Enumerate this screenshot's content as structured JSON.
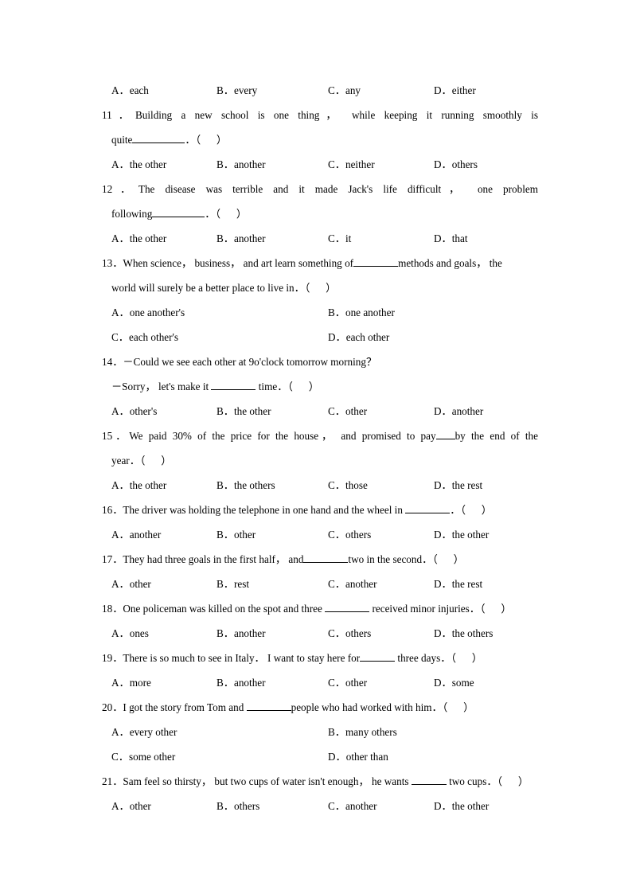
{
  "document": {
    "type": "english-grammar-worksheet",
    "page_background": "#ffffff",
    "text_color": "#000000"
  },
  "questions": [
    {
      "id": "q10-options",
      "number": "",
      "stem_lines": [],
      "option_layout": "cols4",
      "options": [
        {
          "label": "A．",
          "text": "each"
        },
        {
          "label": "B．",
          "text": "every"
        },
        {
          "label": "C．",
          "text": "any"
        },
        {
          "label": "D．",
          "text": "either"
        }
      ]
    },
    {
      "id": "q11",
      "number": "11．",
      "justified": true,
      "stem_line1": "Building a new school is one thing， while keeping it running smoothly is",
      "stem_line2_prefix": "quite",
      "stem_line2_suffix": "．（      ）",
      "blank_size": "w-l",
      "option_layout": "cols4",
      "options": [
        {
          "label": "A．",
          "text": "the other"
        },
        {
          "label": "B．",
          "text": "another"
        },
        {
          "label": "C．",
          "text": "neither"
        },
        {
          "label": "D．",
          "text": "others"
        }
      ]
    },
    {
      "id": "q12",
      "number": "12．",
      "justified": true,
      "stem_line1": "The disease was terrible and it made Jack's life difficult， one problem",
      "stem_line2_prefix": "following",
      "stem_line2_suffix": "．（      ）",
      "blank_size": "w-l",
      "option_layout": "cols4",
      "options": [
        {
          "label": "A．",
          "text": "the other"
        },
        {
          "label": "B．",
          "text": "another"
        },
        {
          "label": "C．",
          "text": "it"
        },
        {
          "label": "D．",
          "text": "that"
        }
      ]
    },
    {
      "id": "q13",
      "number": "13．",
      "justified": false,
      "stem_line1_pre": "When science， business， and art learn something of",
      "stem_line1_post": "methods and goals， the",
      "stem_line2": "world will surely be a better place to live in．（      ）",
      "blank_size": "w-m",
      "option_layout": "cols2",
      "options": [
        {
          "label": "A．",
          "text": "one another's"
        },
        {
          "label": "B．",
          "text": "one another"
        },
        {
          "label": "C．",
          "text": "each other's"
        },
        {
          "label": "D．",
          "text": "each other"
        }
      ]
    },
    {
      "id": "q14",
      "number": "14．",
      "stem_line1": "－Could we see each other at 9o'clock tomorrow morning？",
      "stem_line2_pre": "－Sorry， let's make it ",
      "stem_line2_post": " time．（      ）",
      "blank_size": "w-m",
      "option_layout": "cols4",
      "options": [
        {
          "label": "A．",
          "text": "other's"
        },
        {
          "label": "B．",
          "text": "the other"
        },
        {
          "label": "C．",
          "text": "other"
        },
        {
          "label": "D．",
          "text": "another"
        }
      ]
    },
    {
      "id": "q15",
      "number": "15．",
      "justified": true,
      "stem_line1_pre": "We paid 30% of the price for the house， and promised to pay",
      "stem_line1_post": "by the end of the",
      "stem_line2": "year．（      ）",
      "blank_size": "w-xs",
      "option_layout": "cols4",
      "options": [
        {
          "label": "A．",
          "text": "the other"
        },
        {
          "label": "B．",
          "text": "the others"
        },
        {
          "label": "C．",
          "text": "those"
        },
        {
          "label": "D．",
          "text": "the rest"
        }
      ]
    },
    {
      "id": "q16",
      "number": "16．",
      "stem_pre": "The driver was holding the telephone in one hand and the wheel in ",
      "stem_post": "．（      ）",
      "blank_size": "w-m",
      "option_layout": "cols4",
      "options": [
        {
          "label": "A．",
          "text": "another"
        },
        {
          "label": "B．",
          "text": "other"
        },
        {
          "label": "C．",
          "text": "others"
        },
        {
          "label": "D．",
          "text": "the other"
        }
      ]
    },
    {
      "id": "q17",
      "number": "17．",
      "stem_pre": "They had three goals in the first half， and",
      "stem_post": "two in the second．（      ）",
      "blank_size": "w-m",
      "option_layout": "cols4",
      "options": [
        {
          "label": "A．",
          "text": "other"
        },
        {
          "label": "B．",
          "text": "rest"
        },
        {
          "label": "C．",
          "text": "another"
        },
        {
          "label": "D．",
          "text": "the rest"
        }
      ]
    },
    {
      "id": "q18",
      "number": "18．",
      "stem_pre": "One policeman was killed on the spot and three ",
      "stem_post": " received minor injuries．（      ）",
      "blank_size": "w-m",
      "option_layout": "cols4",
      "options": [
        {
          "label": "A．",
          "text": "ones"
        },
        {
          "label": "B．",
          "text": "another"
        },
        {
          "label": "C．",
          "text": "others"
        },
        {
          "label": "D．",
          "text": "the others"
        }
      ]
    },
    {
      "id": "q19",
      "number": "19．",
      "stem_pre": "There is so much to see in Italy． I want to stay here for",
      "stem_post": " three days．（      ）",
      "blank_size": "w-s",
      "option_layout": "cols4",
      "options": [
        {
          "label": "A．",
          "text": "more"
        },
        {
          "label": "B．",
          "text": "another"
        },
        {
          "label": "C．",
          "text": "other"
        },
        {
          "label": "D．",
          "text": "some"
        }
      ]
    },
    {
      "id": "q20",
      "number": "20．",
      "stem_pre": "I got the story from Tom and ",
      "stem_post": "people who had worked with him．（      ）",
      "blank_size": "w-m",
      "option_layout": "cols2",
      "options": [
        {
          "label": "A．",
          "text": "every other"
        },
        {
          "label": "B．",
          "text": "many others"
        },
        {
          "label": "C．",
          "text": "some other"
        },
        {
          "label": "D．",
          "text": "other than"
        }
      ]
    },
    {
      "id": "q21",
      "number": "21．",
      "stem_pre": "Sam feel so thirsty， but two cups of water isn't enough， he wants ",
      "stem_post": " two cups．（      ）",
      "blank_size": "w-s",
      "option_layout": "cols4",
      "options": [
        {
          "label": "A．",
          "text": "other"
        },
        {
          "label": "B．",
          "text": "others"
        },
        {
          "label": "C．",
          "text": "another"
        },
        {
          "label": "D．",
          "text": "the other"
        }
      ]
    }
  ]
}
